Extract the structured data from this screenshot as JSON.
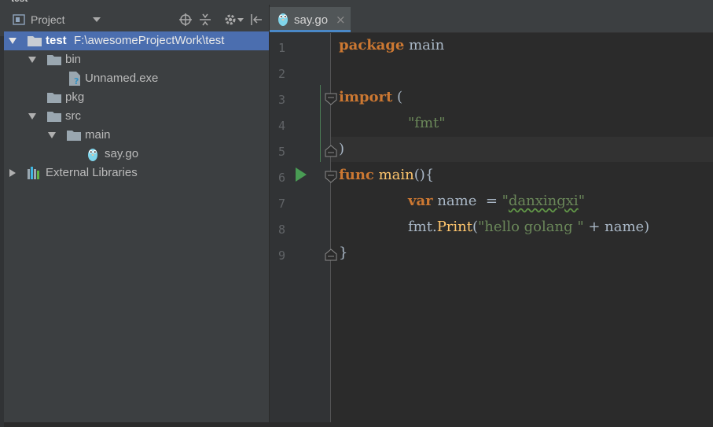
{
  "window": {
    "breadcrumb": "test"
  },
  "project_panel": {
    "title": "Project",
    "icons": [
      "project-view-icon",
      "dropdown-arrow-icon",
      "locate-icon",
      "collapse-all-icon",
      "gear-icon",
      "hide-panel-icon"
    ],
    "tree": [
      {
        "label": "test",
        "path": "F:\\awesomeProjectWork\\test",
        "icon": "folder-icon",
        "expanded": true,
        "selected": true
      },
      {
        "label": "bin",
        "icon": "folder-icon",
        "expanded": true
      },
      {
        "label": "Unnamed.exe",
        "icon": "unknown-file-icon"
      },
      {
        "label": "pkg",
        "icon": "folder-icon"
      },
      {
        "label": "src",
        "icon": "folder-icon",
        "expanded": true
      },
      {
        "label": "main",
        "icon": "folder-icon",
        "expanded": true
      },
      {
        "label": "say.go",
        "icon": "go-file-icon"
      },
      {
        "label": "External Libraries",
        "icon": "libraries-icon",
        "expanded": false
      }
    ]
  },
  "editor": {
    "tabs": [
      {
        "label": "say.go",
        "close": "×",
        "active": true
      }
    ],
    "line_numbers": [
      "1",
      "2",
      "3",
      "4",
      "5",
      "6",
      "7",
      "8",
      "9"
    ],
    "code": {
      "l1": {
        "kw": "package",
        "ident": " main"
      },
      "l3": {
        "kw": "import",
        "rest": " ("
      },
      "l4": {
        "str": "\"fmt\""
      },
      "l5": {
        "text": ")"
      },
      "l6": {
        "kw": "func",
        "name": " main",
        "rest": "(){"
      },
      "l7": {
        "kw": "var",
        "ident": " name  = ",
        "q1": "\"",
        "typo": "danxingxi",
        "q2": "\""
      },
      "l8": {
        "recv": "fmt.",
        "fn": "Print",
        "open": "(",
        "str": "\"hello golang \"",
        "rest": " + name)"
      },
      "l9": {
        "text": "}"
      }
    },
    "colors": {
      "keyword": "#cc7832",
      "string": "#6a8759",
      "function": "#ffc66d",
      "identifier": "#a9b7c6",
      "run": "#499c54",
      "selection": "#4b6eaf"
    }
  }
}
